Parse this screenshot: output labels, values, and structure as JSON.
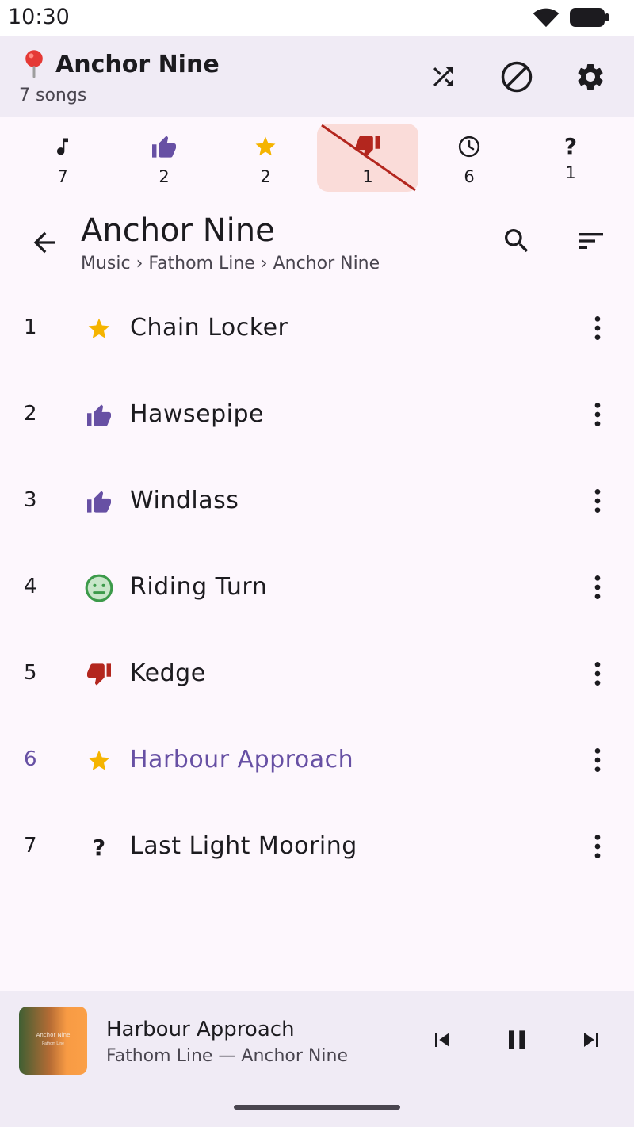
{
  "status_bar": {
    "time": "10:30"
  },
  "appbar": {
    "title": "Anchor Nine",
    "subtitle": "7 songs",
    "icons": [
      "pin-icon",
      "shuffle-icon",
      "block-icon",
      "settings-icon"
    ]
  },
  "filters": [
    {
      "icon": "music-note-icon",
      "count": "7",
      "active": false
    },
    {
      "icon": "thumbs-up-icon",
      "count": "2",
      "active": false
    },
    {
      "icon": "star-icon",
      "count": "2",
      "active": false
    },
    {
      "icon": "thumbs-down-icon",
      "count": "1",
      "active": true
    },
    {
      "icon": "clock-icon",
      "count": "6",
      "active": false
    },
    {
      "icon": "question-icon",
      "count": "1",
      "active": false
    }
  ],
  "header": {
    "title": "Anchor Nine",
    "breadcrumb": "Music › Fathom Line › Anchor Nine"
  },
  "tracks": [
    {
      "num": "1",
      "title": "Chain Locker",
      "rating": "star-icon"
    },
    {
      "num": "2",
      "title": "Hawsepipe",
      "rating": "thumbs-up-icon"
    },
    {
      "num": "3",
      "title": "Windlass",
      "rating": "thumbs-up-icon"
    },
    {
      "num": "4",
      "title": "Riding Turn",
      "rating": "neutral-face-icon"
    },
    {
      "num": "5",
      "title": "Kedge",
      "rating": "thumbs-down-icon"
    },
    {
      "num": "6",
      "title": "Harbour Approach",
      "rating": "star-icon",
      "playing": true
    },
    {
      "num": "7",
      "title": "Last Light Mooring",
      "rating": "question-icon"
    }
  ],
  "player": {
    "title": "Harbour Approach",
    "subtitle": "Fathom Line — Anchor Nine",
    "album_art_text": "Anchor Nine",
    "album_art_sub": "Fathom Line"
  },
  "colors": {
    "accent": "#6750a4",
    "star": "#f5b400",
    "thumbs_up": "#6750a4",
    "thumbs_down": "#b3261e",
    "neutral": "#3c9a4a",
    "active_filter_bg": "#fadcd9"
  }
}
